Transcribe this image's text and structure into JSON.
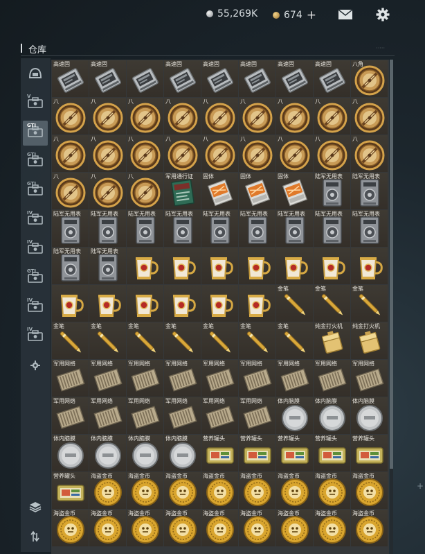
{
  "currency": {
    "silver": "55,269K",
    "gold": "674",
    "add": "+"
  },
  "header": {
    "title": "仓库",
    "capacity": "·····"
  },
  "sidebar": {
    "tabs": [
      {
        "label": "",
        "icon": "helmet-icon"
      },
      {
        "label": "V",
        "icon": "case-icon"
      },
      {
        "label": "GTI",
        "icon": "case-icon"
      },
      {
        "label": "GTI",
        "icon": "case-icon"
      },
      {
        "label": "GTI",
        "icon": "case-icon"
      },
      {
        "label": "IV",
        "icon": "case-icon"
      },
      {
        "label": "IV",
        "icon": "case-icon"
      },
      {
        "label": "GTI",
        "icon": "case-icon"
      },
      {
        "label": "IV",
        "icon": "case-icon"
      },
      {
        "label": "IV",
        "icon": "case-icon"
      },
      {
        "label": "",
        "icon": "gear-icon"
      }
    ],
    "active_tab": 2
  },
  "grid": {
    "rows": [
      [
        {
          "n": "高速固",
          "t": "ssd"
        },
        {
          "n": "高速固",
          "t": "ssd"
        },
        {
          "n": "",
          "t": "ssd"
        },
        {
          "n": "高速固",
          "t": "ssd"
        },
        {
          "n": "高速固",
          "t": "ssd"
        },
        {
          "n": "高速固",
          "t": "ssd"
        },
        {
          "n": "高速固",
          "t": "ssd"
        },
        {
          "n": "高速固",
          "t": "ssd"
        },
        {
          "n": "八角",
          "t": "watch"
        }
      ],
      [
        {
          "n": "八",
          "t": "watch"
        },
        {
          "n": "八",
          "t": "watch"
        },
        {
          "n": "八",
          "t": "watch"
        },
        {
          "n": "八",
          "t": "watch"
        },
        {
          "n": "八",
          "t": "watch"
        },
        {
          "n": "八",
          "t": "watch"
        },
        {
          "n": "八",
          "t": "watch"
        },
        {
          "n": "八",
          "t": "watch"
        },
        {
          "n": "八",
          "t": "watch"
        }
      ],
      [
        {
          "n": "八",
          "t": "watch"
        },
        {
          "n": "八",
          "t": "watch"
        },
        {
          "n": "八",
          "t": "watch"
        },
        {
          "n": "八",
          "t": "watch"
        },
        {
          "n": "八",
          "t": "watch"
        },
        {
          "n": "八",
          "t": "watch"
        },
        {
          "n": "八",
          "t": "watch"
        },
        {
          "n": "八",
          "t": "watch"
        },
        {
          "n": "八",
          "t": "watch"
        }
      ],
      [
        {
          "n": "八",
          "t": "watch"
        },
        {
          "n": "八",
          "t": "watch"
        },
        {
          "n": "八",
          "t": "watch"
        },
        {
          "n": "军用通行证",
          "t": "pass"
        },
        {
          "n": "固体",
          "t": "fuel"
        },
        {
          "n": "固体",
          "t": "fuel"
        },
        {
          "n": "固体",
          "t": "fuel"
        },
        {
          "n": "陆军无用表",
          "t": "radio"
        },
        {
          "n": "陆军无用表",
          "t": "radio"
        }
      ],
      [
        {
          "n": "陆军无用表",
          "t": "radio"
        },
        {
          "n": "陆军无用表",
          "t": "radio"
        },
        {
          "n": "陆军无用表",
          "t": "radio"
        },
        {
          "n": "陆军无用表",
          "t": "radio"
        },
        {
          "n": "陆军无用表",
          "t": "radio"
        },
        {
          "n": "陆军无用表",
          "t": "radio"
        },
        {
          "n": "陆军无用表",
          "t": "radio"
        },
        {
          "n": "陆军无用表",
          "t": "radio"
        },
        {
          "n": "陆军无用表",
          "t": "radio"
        }
      ],
      [
        {
          "n": "陆军无用表",
          "t": "radio"
        },
        {
          "n": "陆军无用表",
          "t": "radio"
        },
        {
          "n": "",
          "t": "cup"
        },
        {
          "n": "",
          "t": "cup"
        },
        {
          "n": "",
          "t": "cup"
        },
        {
          "n": "",
          "t": "cup"
        },
        {
          "n": "",
          "t": "cup"
        },
        {
          "n": "",
          "t": "cup"
        },
        {
          "n": "",
          "t": "cup"
        }
      ],
      [
        {
          "n": "",
          "t": "cup"
        },
        {
          "n": "",
          "t": "cup"
        },
        {
          "n": "",
          "t": "cup"
        },
        {
          "n": "",
          "t": "cup"
        },
        {
          "n": "",
          "t": "cup"
        },
        {
          "n": "",
          "t": "cup"
        },
        {
          "n": "金笔",
          "t": "pen"
        },
        {
          "n": "金笔",
          "t": "pen"
        },
        {
          "n": "金笔",
          "t": "pen"
        }
      ],
      [
        {
          "n": "金笔",
          "t": "pen"
        },
        {
          "n": "金笔",
          "t": "pen"
        },
        {
          "n": "金笔",
          "t": "pen"
        },
        {
          "n": "金笔",
          "t": "pen"
        },
        {
          "n": "金笔",
          "t": "pen"
        },
        {
          "n": "金笔",
          "t": "pen"
        },
        {
          "n": "金笔",
          "t": "pen"
        },
        {
          "n": "纯金打火机",
          "t": "lighter"
        },
        {
          "n": "纯金打火机",
          "t": "lighter"
        }
      ],
      [
        {
          "n": "军用网络",
          "t": "net"
        },
        {
          "n": "军用网络",
          "t": "net"
        },
        {
          "n": "军用网络",
          "t": "net"
        },
        {
          "n": "军用网络",
          "t": "net"
        },
        {
          "n": "军用网络",
          "t": "net"
        },
        {
          "n": "军用网络",
          "t": "net"
        },
        {
          "n": "军用网络",
          "t": "net"
        },
        {
          "n": "军用网络",
          "t": "net"
        },
        {
          "n": "军用网络",
          "t": "net"
        }
      ],
      [
        {
          "n": "军用网络",
          "t": "net"
        },
        {
          "n": "军用网络",
          "t": "net"
        },
        {
          "n": "军用网络",
          "t": "net"
        },
        {
          "n": "军用网络",
          "t": "net"
        },
        {
          "n": "军用网络",
          "t": "net"
        },
        {
          "n": "军用网络",
          "t": "net"
        },
        {
          "n": "体内脑膜",
          "t": "disc"
        },
        {
          "n": "体内脑膜",
          "t": "disc"
        },
        {
          "n": "体内脑膜",
          "t": "disc"
        }
      ],
      [
        {
          "n": "体内脑膜",
          "t": "disc"
        },
        {
          "n": "体内脑膜",
          "t": "disc"
        },
        {
          "n": "体内脑膜",
          "t": "disc"
        },
        {
          "n": "体内脑膜",
          "t": "disc"
        },
        {
          "n": "营养罐头",
          "t": "can"
        },
        {
          "n": "营养罐头",
          "t": "can"
        },
        {
          "n": "营养罐头",
          "t": "can"
        },
        {
          "n": "营养罐头",
          "t": "can"
        },
        {
          "n": "营养罐头",
          "t": "can"
        }
      ],
      [
        {
          "n": "营养罐头",
          "t": "can"
        },
        {
          "n": "海盗金币",
          "t": "coin"
        },
        {
          "n": "海盗金币",
          "t": "coin"
        },
        {
          "n": "海盗金币",
          "t": "coin"
        },
        {
          "n": "海盗金币",
          "t": "coin"
        },
        {
          "n": "海盗金币",
          "t": "coin"
        },
        {
          "n": "海盗金币",
          "t": "coin"
        },
        {
          "n": "海盗金币",
          "t": "coin"
        },
        {
          "n": "海盗金币",
          "t": "coin"
        }
      ],
      [
        {
          "n": "海盗金币",
          "t": "coin"
        },
        {
          "n": "海盗金币",
          "t": "coin"
        },
        {
          "n": "海盗金币",
          "t": "coin"
        },
        {
          "n": "海盗金币",
          "t": "coin"
        },
        {
          "n": "海盗金币",
          "t": "coin"
        },
        {
          "n": "海盗金币",
          "t": "coin"
        },
        {
          "n": "海盗金币",
          "t": "coin"
        },
        {
          "n": "海盗金币",
          "t": "coin"
        },
        {
          "n": "海盗金币",
          "t": "coin"
        }
      ]
    ]
  }
}
